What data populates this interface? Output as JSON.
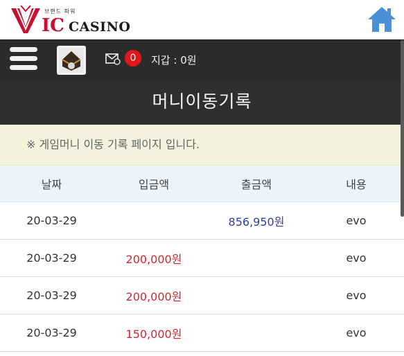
{
  "brand": {
    "tagline": "브랜드 파워",
    "name_main": "IC",
    "name_rest": "CASINO"
  },
  "navbar": {
    "badge_count": "0",
    "wallet_text": "지갑 : 0원"
  },
  "page_title": "머니이동기록",
  "notice": "※ 게임머니 이동 기록 페이지 입니다.",
  "table": {
    "headers": [
      "날짜",
      "입금액",
      "출금액",
      "내용"
    ],
    "rows": [
      [
        "20-03-29",
        "",
        "856,950원",
        "evo"
      ],
      [
        "20-03-29",
        "200,000원",
        "",
        "evo"
      ],
      [
        "20-03-29",
        "200,000원",
        "",
        "evo"
      ],
      [
        "20-03-29",
        "150,000원",
        "",
        "evo"
      ]
    ]
  },
  "colors": {
    "deposit": "#d9242b",
    "withdraw": "#2d3fa8",
    "brand_red": "#c8102e",
    "home_blue": "#4a90d9"
  },
  "icons": [
    "home-icon",
    "menu-icon",
    "avatar-icon",
    "mail-icon"
  ]
}
